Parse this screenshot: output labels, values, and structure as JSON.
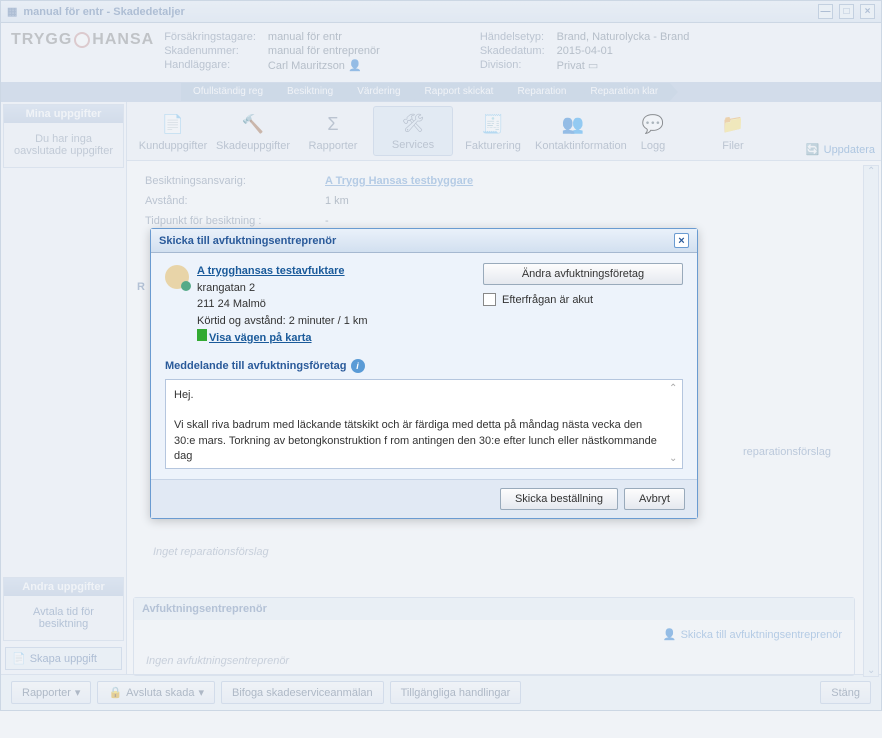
{
  "window": {
    "title": "manual för entr - Skadedetaljer"
  },
  "header": {
    "logo": "TRYGG HANSA",
    "forsakringstagare_label": "Försäkringstagare:",
    "forsakringstagare": "manual för entr",
    "skadenummer_label": "Skadenummer:",
    "skadenummer": "manual för entreprenör",
    "handlaggare_label": "Handläggare:",
    "handlaggare": "Carl Mauritzson",
    "handelsetyp_label": "Händelsetyp:",
    "handelsetyp": "Brand, Naturolycka - Brand",
    "skadedatum_label": "Skadedatum:",
    "skadedatum": "2015-04-01",
    "division_label": "Division:",
    "division": "Privat"
  },
  "progress": [
    "Ofullständig reg",
    "Besiktning",
    "Värdering",
    "Rapport skickat",
    "Reparation",
    "Reparation klar"
  ],
  "sidebar": {
    "panel1_title": "Mina uppgifter",
    "panel1_body": "Du har inga oavslutade uppgifter",
    "panel2_title": "Andra uppgifter",
    "panel2_body": "Avtala tid för besiktning",
    "create_task": "Skapa uppgift"
  },
  "toolbar": {
    "items": [
      "Kunduppgifter",
      "Skadeuppgifter",
      "Rapporter",
      "Services",
      "Fakturering",
      "Kontaktinformation",
      "Logg",
      "Filer"
    ],
    "update": "Uppdatera"
  },
  "details": {
    "besiktning_label": "Besiktningsansvarig:",
    "besiktning_val": "A Trygg Hansas testbyggare",
    "avstand_label": "Avstånd:",
    "avstand_val": "1 km",
    "tidpunkt_label": "Tidpunkt för besiktning :",
    "tidpunkt_val": "-"
  },
  "rep_section": {
    "partial": "R",
    "link_txt": "reparationsförslag",
    "empty": "Inget reparationsförslag"
  },
  "avfukt_section": {
    "title": "Avfuktningsentreprenör",
    "send_link": "Skicka till avfuktningsentreprenör",
    "empty": "Ingen avfuktningsentreprenör"
  },
  "bottom": {
    "rapporter": "Rapporter",
    "avsluta": "Avsluta skada",
    "bifoga": "Bifoga skadeserviceanmälan",
    "tillganglig": "Tillgängliga handlingar",
    "stang": "Stäng"
  },
  "dialog": {
    "title": "Skicka till avfuktningsentreprenör",
    "contractor_link": "A trygghansas testavfuktare",
    "addr1": "krangatan 2",
    "addr2": "211 24 Malmö",
    "kortid": "Körtid og avstånd: 2 minuter / 1 km",
    "map_link": "Visa vägen på karta",
    "change_btn": "Ändra avfuktningsföretag",
    "urgent_label": "Efterfrågan är akut",
    "msg_label": "Meddelande till avfuktningsföretag",
    "msg_body": "Hej.\n\nVi skall riva badrum med läckande tätskikt och är färdiga med detta på måndag nästa vecka den 30:e mars. Torkning av betongkonstruktion f rom antingen den 30:e efter lunch eller nästkommande dag",
    "send": "Skicka beställning",
    "cancel": "Avbryt"
  }
}
